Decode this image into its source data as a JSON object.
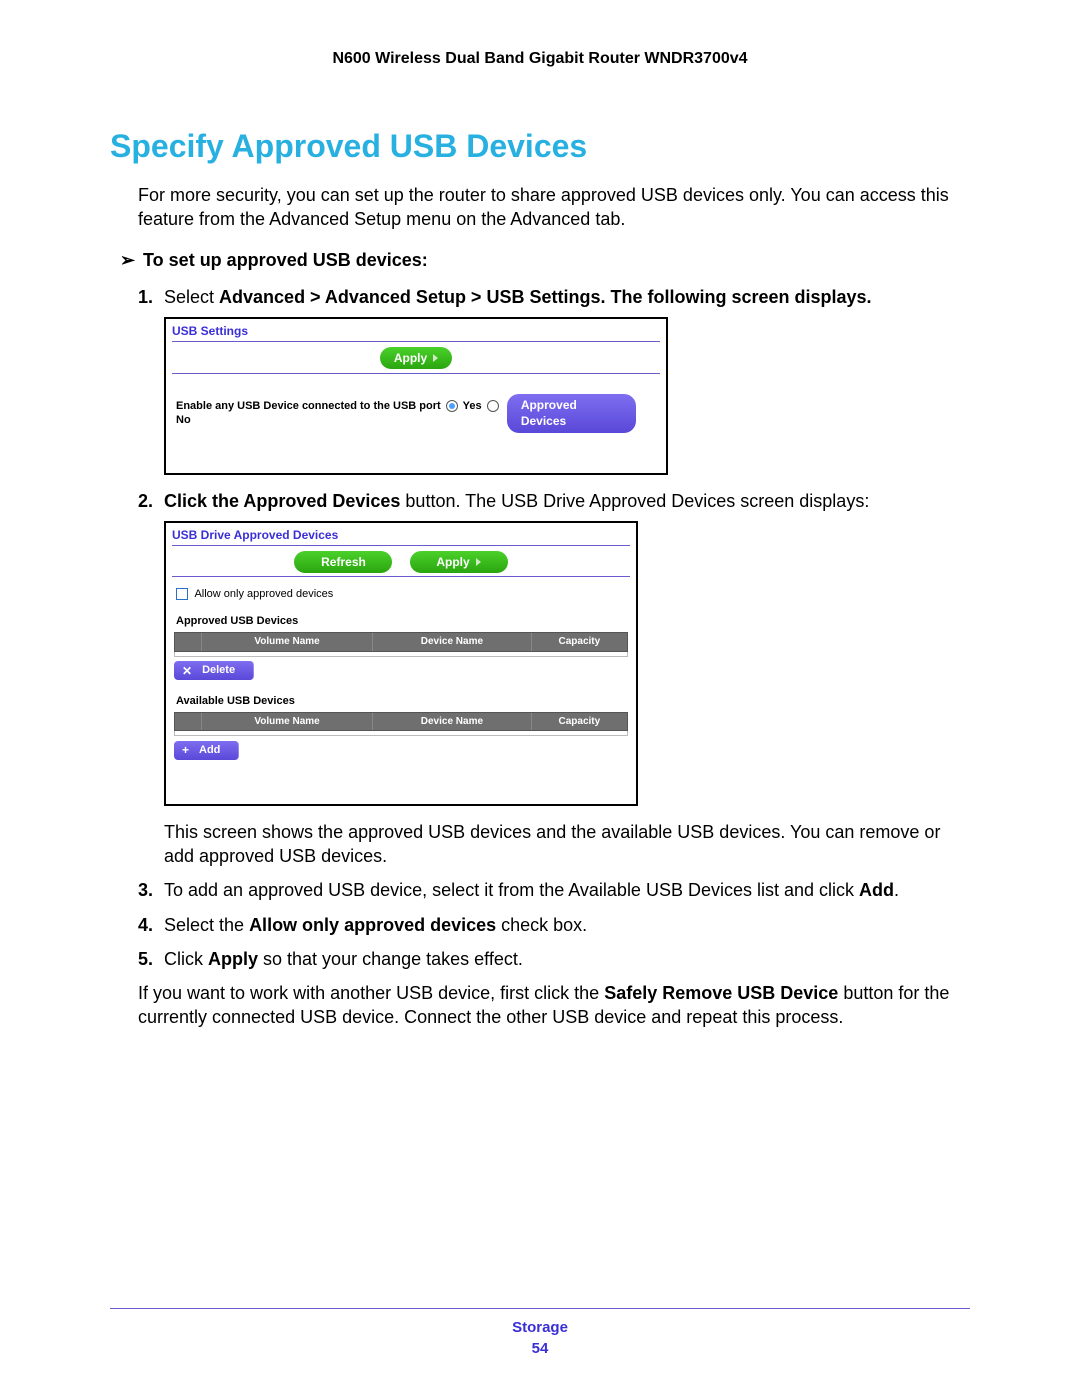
{
  "header": {
    "product": "N600 Wireless Dual Band Gigabit Router WNDR3700v4"
  },
  "section": {
    "heading": "Specify Approved USB Devices"
  },
  "intro": "For more security, you can set up the router to share approved USB devices only. You can access this feature from the Advanced Setup menu on the Advanced tab.",
  "task": {
    "arrow": "➢",
    "title": "To set up approved USB devices:"
  },
  "steps": {
    "s1_a": "Select ",
    "s1_b": "Advanced > Advanced Setup > USB Settings. The following screen displays.",
    "s2_a": "Click the Approved Devices",
    "s2_b": " button. The USB Drive Approved Devices screen displays:",
    "s2_desc": "This screen shows the approved USB devices and the available USB devices. You can remove or add approved USB devices.",
    "s3_a": "To add an approved USB device, select it from the Available USB Devices list and click ",
    "s3_b": "Add",
    "s3_c": ".",
    "s4_a": "Select the ",
    "s4_b": "Allow only approved devices",
    "s4_c": " check box.",
    "s5_a": "Click ",
    "s5_b": "Apply",
    "s5_c": " so that your change takes effect."
  },
  "closing_a": "If you want to work with another USB device, first click the ",
  "closing_b": "Safely Remove USB Device",
  "closing_c": " button for the currently connected USB device. Connect the other USB device and repeat this process.",
  "shot1": {
    "title": "USB Settings",
    "apply": "Apply",
    "enable_label": "Enable any USB Device connected to the USB port",
    "yes": "Yes",
    "no": "No",
    "approved_btn": "Approved Devices"
  },
  "shot2": {
    "title": "USB Drive Approved Devices",
    "refresh": "Refresh",
    "apply": "Apply",
    "allow_label": "Allow only approved devices",
    "group_approved": "Approved USB Devices",
    "group_available": "Available USB Devices",
    "col_volume": "Volume Name",
    "col_device": "Device Name",
    "col_capacity": "Capacity",
    "delete_sym": "✕",
    "delete": "Delete",
    "add_sym": "+",
    "add": "Add"
  },
  "footer": {
    "category": "Storage",
    "page": "54"
  }
}
